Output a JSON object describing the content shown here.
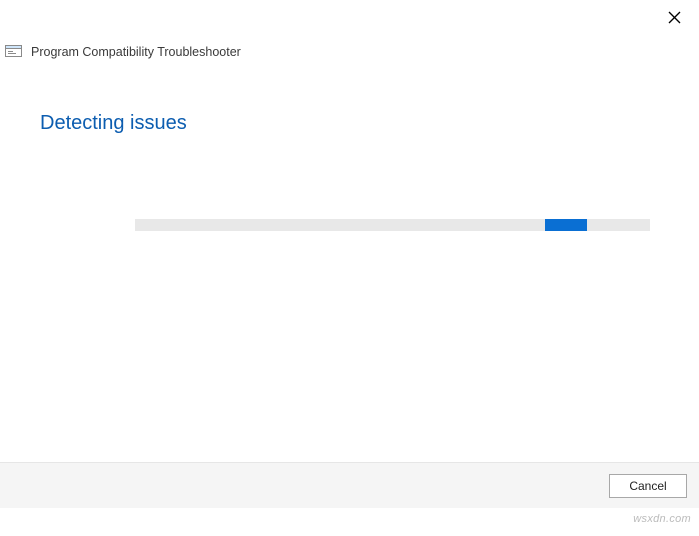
{
  "window": {
    "title": "Program Compatibility Troubleshooter"
  },
  "main": {
    "heading": "Detecting issues"
  },
  "footer": {
    "cancel_label": "Cancel"
  },
  "watermark": "wsxdn.com",
  "colors": {
    "accent": "#0c5db0",
    "progress_fill": "#0a6fd3",
    "progress_track": "#e8e8e8",
    "footer_bg": "#f5f5f5"
  }
}
